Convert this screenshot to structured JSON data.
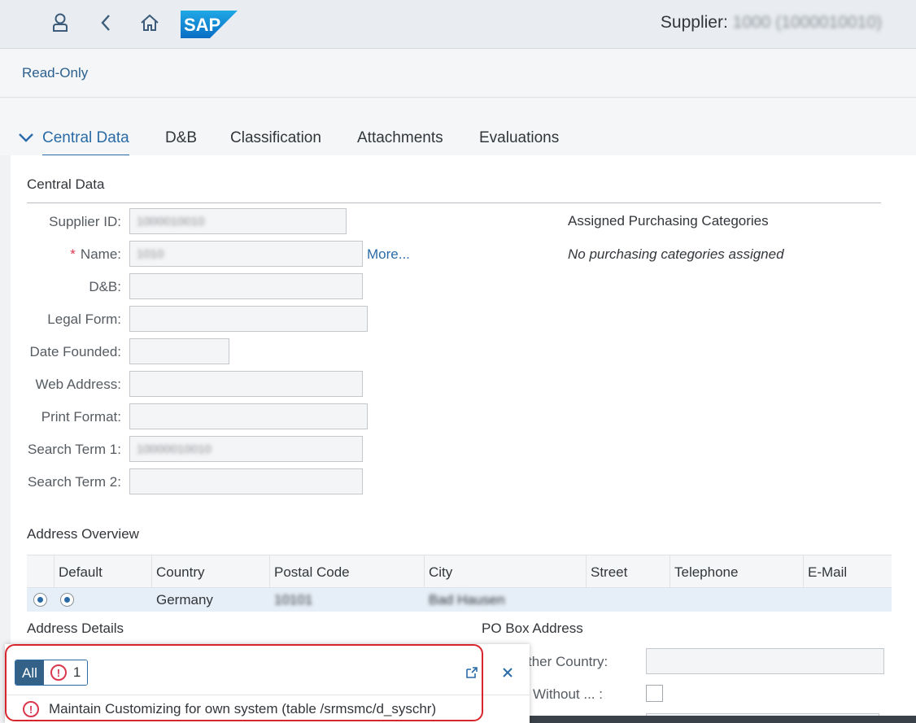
{
  "shell": {
    "title_prefix": "Supplier:",
    "title_masked_id": "1000",
    "title_masked_detail": "(1000010010)",
    "logo_text": "SAP",
    "icons": [
      "user-icon",
      "back-icon",
      "home-icon"
    ]
  },
  "subheader": {
    "mode": "Read-Only"
  },
  "tabs": [
    "Central Data",
    "D&B",
    "Classification",
    "Attachments",
    "Evaluations"
  ],
  "central_data": {
    "title": "Central Data",
    "fields": {
      "supplier_id": {
        "label": "Supplier ID:",
        "value": "1000010010"
      },
      "name": {
        "label": "Name:",
        "value": "1010",
        "required_mark": "*",
        "more": "More..."
      },
      "dnb": {
        "label": "D&B:",
        "value": ""
      },
      "legal_form": {
        "label": "Legal Form:",
        "value": ""
      },
      "date_founded": {
        "label": "Date Founded:",
        "value": ""
      },
      "web_address": {
        "label": "Web Address:",
        "value": ""
      },
      "print_format": {
        "label": "Print Format:",
        "value": ""
      },
      "search_term_1": {
        "label": "Search Term 1:",
        "value": "10000010010"
      },
      "search_term_2": {
        "label": "Search Term 2:",
        "value": ""
      }
    },
    "purchasing": {
      "title": "Assigned Purchasing Categories",
      "empty_text": "No purchasing categories assigned"
    }
  },
  "address_overview": {
    "title": "Address Overview",
    "columns": [
      "Default",
      "Country",
      "Postal Code",
      "City",
      "Street",
      "Telephone",
      "E-Mail"
    ],
    "rows": [
      {
        "country": "Germany",
        "postal_code": "10101",
        "city": "Bad Hausen",
        "street": "",
        "telephone": "",
        "email": ""
      }
    ]
  },
  "address_details": {
    "title": "Address Details"
  },
  "po_box": {
    "title": "PO Box Address",
    "other_country_label": "ther Country:",
    "without_label": "Without ... :"
  },
  "messages": {
    "filter_all": "All",
    "error_count": "1",
    "items": [
      {
        "type": "error",
        "text": "Maintain Customizing for own system (table /srmsmc/d_syschr)"
      }
    ]
  }
}
